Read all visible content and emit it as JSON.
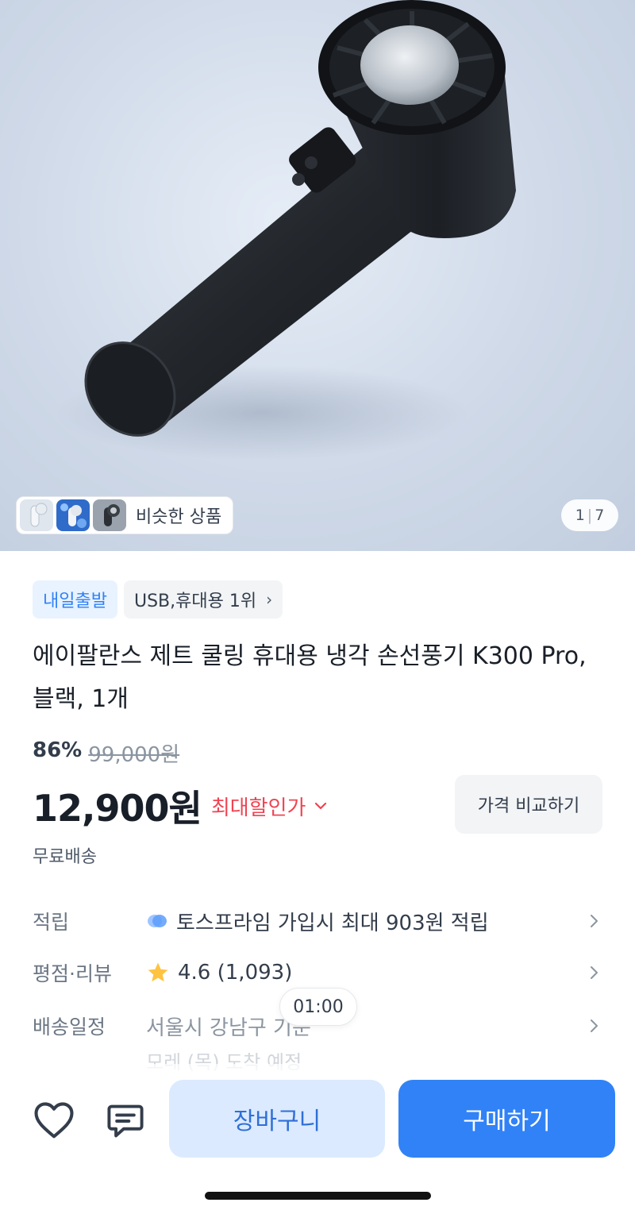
{
  "gallery": {
    "similar_label": "비슷한 상품",
    "page_current": "1",
    "page_total": "7"
  },
  "tags": {
    "delivery": "내일출발",
    "ranking": "USB,휴대용 1위"
  },
  "product": {
    "title": "에이팔란스 제트 쿨링 휴대용 냉각 손선풍기 K300 Pro, 블랙, 1개",
    "discount_rate": "86%",
    "original_price": "99,000원",
    "price": "12,900원",
    "best_price_label": "최대할인가",
    "shipping": "무료배송"
  },
  "compare_button": "가격 비교하기",
  "info": {
    "points_key": "적립",
    "points_value": "토스프라임 가입시 최대 903원 적립",
    "rating_key": "평점·리뷰",
    "rating_value": "4.6 (1,093)",
    "delivery_key": "배송일정",
    "delivery_value": "서울시 강남구 기준",
    "delivery_date": "모레 (목) 도착 예정"
  },
  "time_bubble": "01:00",
  "actions": {
    "cart": "장바구니",
    "buy": "구매하기"
  },
  "colors": {
    "accent": "#3182f6",
    "sale": "#f04452",
    "cart_bg": "#dbeafe"
  },
  "icons": [
    "heart-icon",
    "chat-icon",
    "chevron-right-icon",
    "chevron-down-icon",
    "star-icon",
    "toss-points-icon"
  ]
}
